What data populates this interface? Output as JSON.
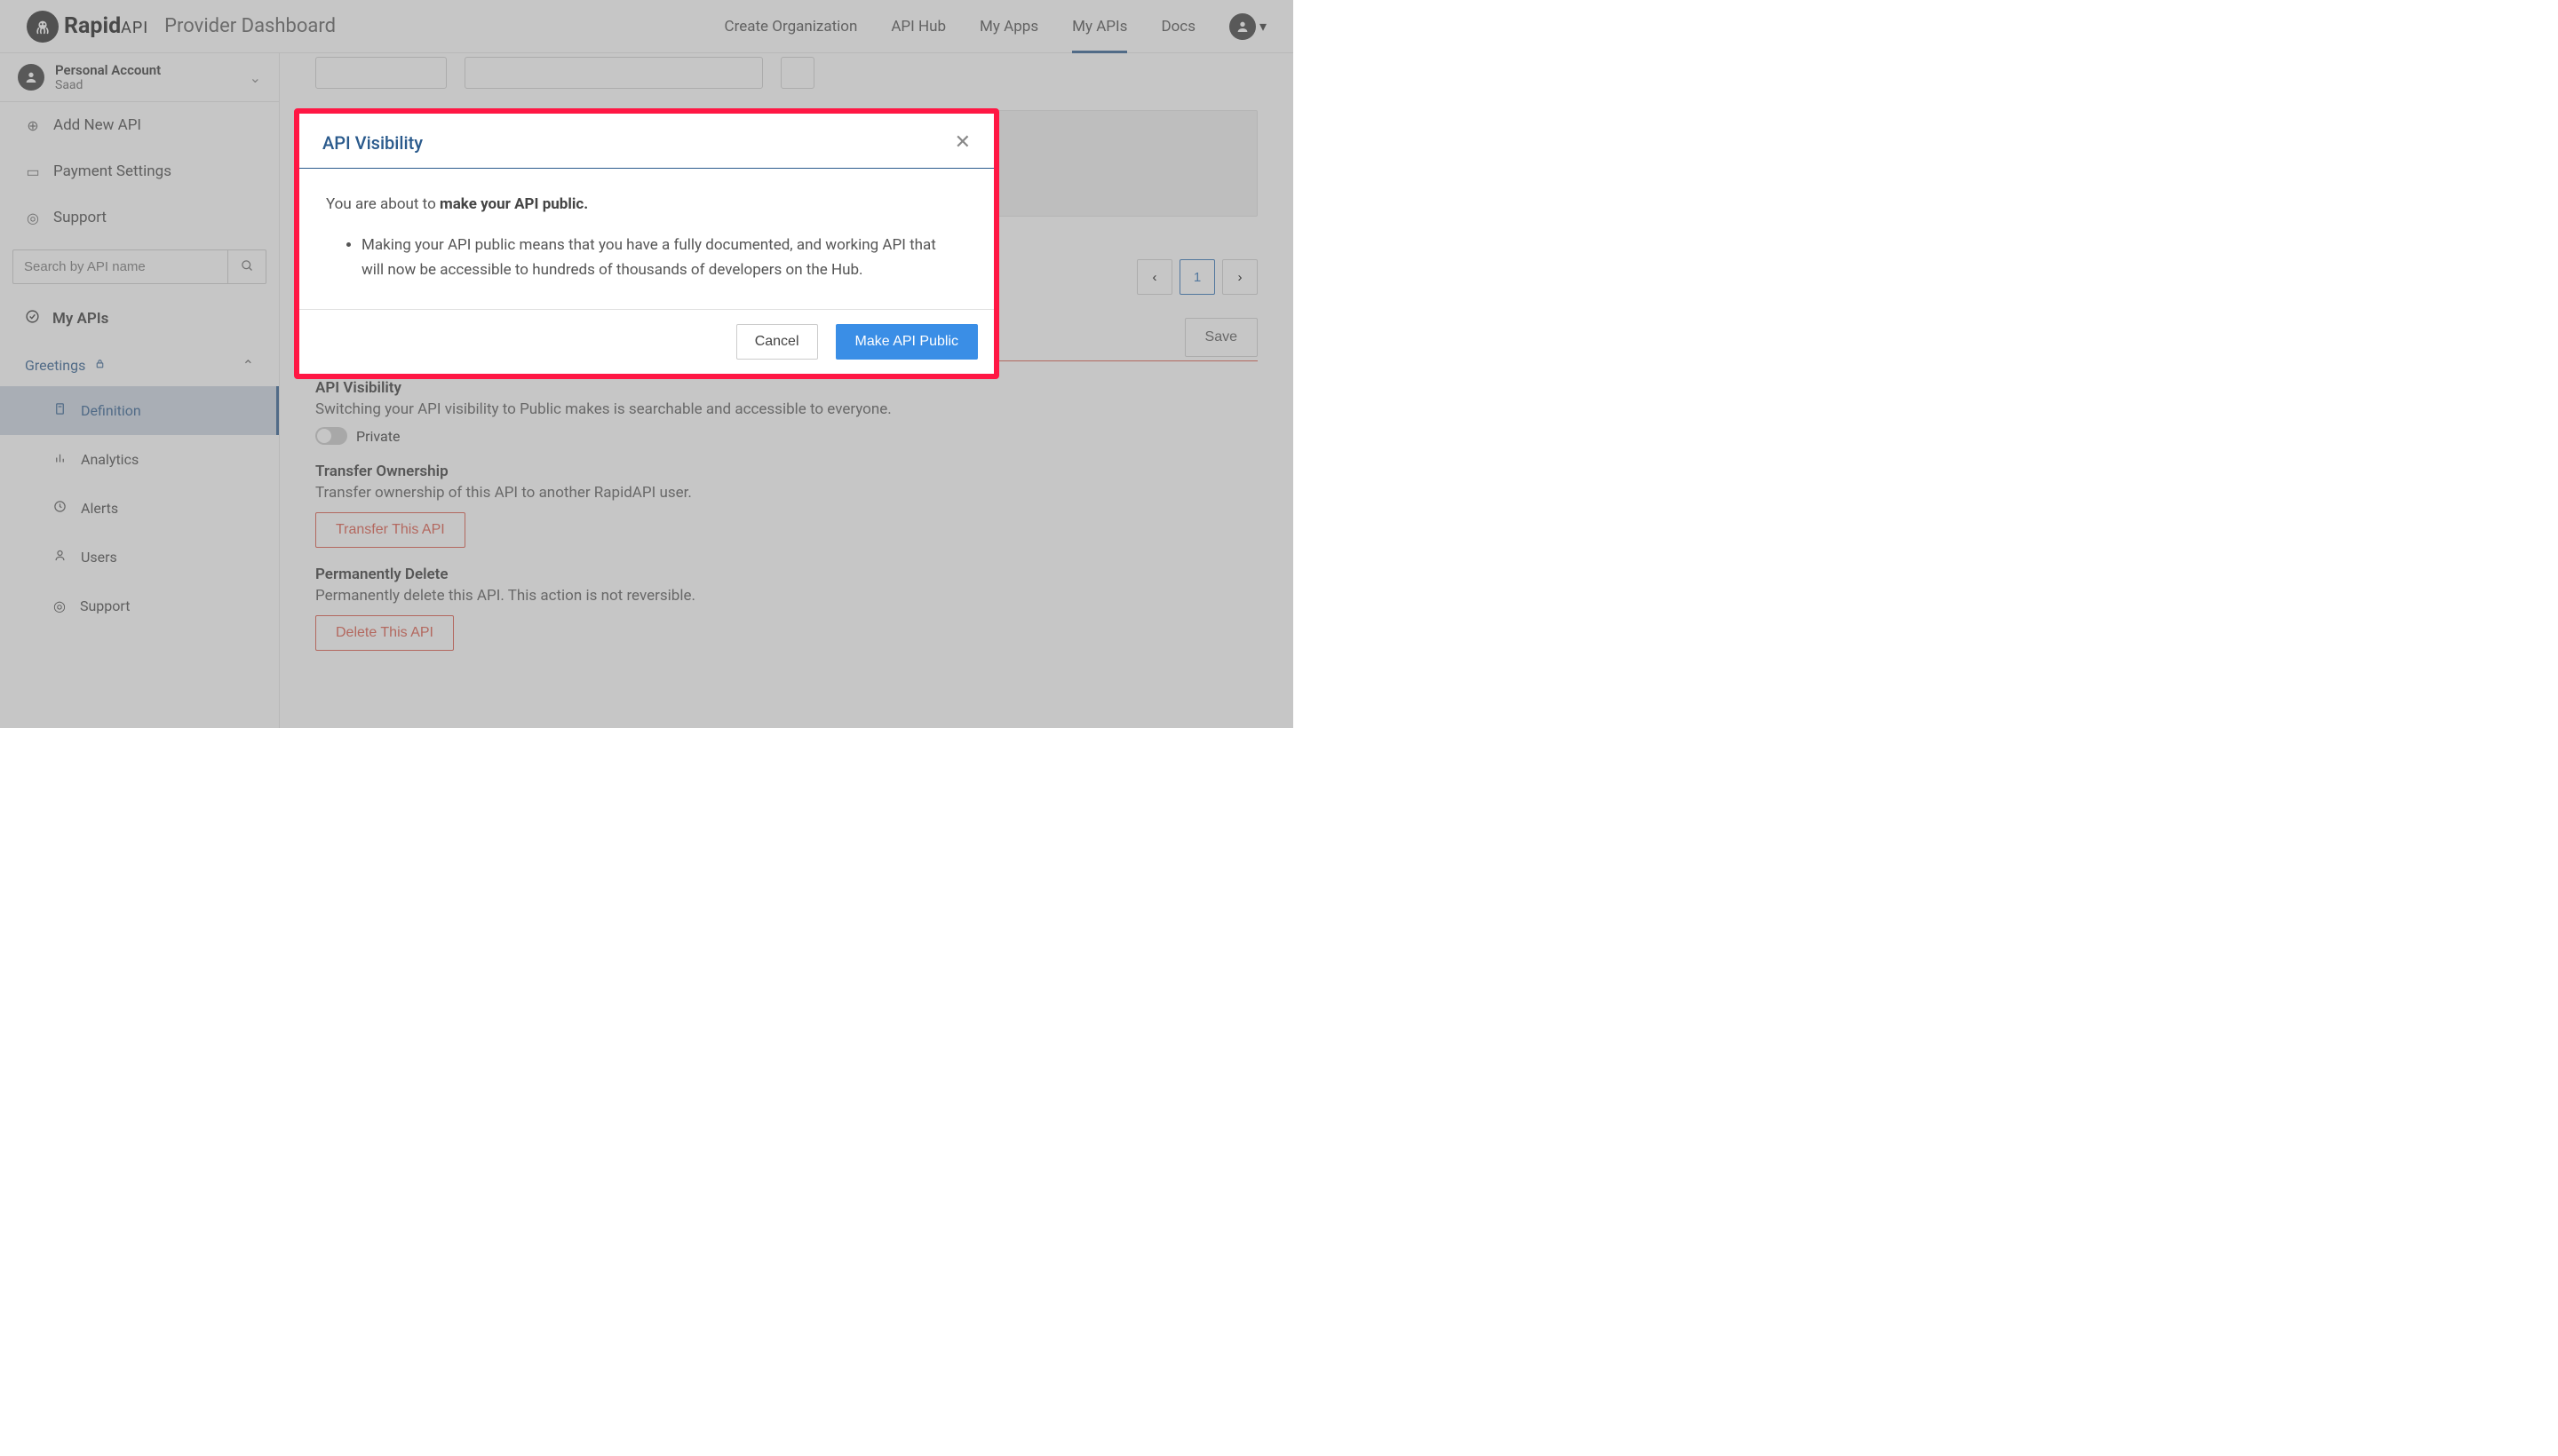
{
  "header": {
    "brand_rapid": "Rapid",
    "brand_api": "API",
    "subtitle": "Provider Dashboard",
    "nav": {
      "create_org": "Create Organization",
      "api_hub": "API Hub",
      "my_apps": "My Apps",
      "my_apis": "My APIs",
      "docs": "Docs"
    }
  },
  "account": {
    "title": "Personal Account",
    "name": "Saad"
  },
  "sidebar": {
    "add_new_api": "Add New API",
    "payment_settings": "Payment Settings",
    "support": "Support",
    "search_placeholder": "Search by API name",
    "my_apis_header": "My APIs",
    "api_name": "Greetings",
    "sub": {
      "definition": "Definition",
      "analytics": "Analytics",
      "alerts": "Alerts",
      "users": "Users",
      "support": "Support"
    }
  },
  "main": {
    "page_number": "1",
    "save": "Save",
    "sections": {
      "visibility": {
        "title": "API Visibility",
        "desc": "Switching your API visibility to Public makes is searchable and accessible to everyone.",
        "toggle_label": "Private"
      },
      "transfer": {
        "title": "Transfer Ownership",
        "desc": "Transfer ownership of this API to another RapidAPI user.",
        "button": "Transfer This API"
      },
      "delete": {
        "title": "Permanently Delete",
        "desc": "Permanently delete this API. This action is not reversible.",
        "button": "Delete This API"
      }
    }
  },
  "modal": {
    "title": "API Visibility",
    "intro_pre": "You are about to ",
    "intro_strong": "make your API public.",
    "bullet": "Making your API public means that you have a fully documented, and working API that will now be accessible to hundreds of thousands of developers on the Hub.",
    "cancel": "Cancel",
    "confirm": "Make API Public"
  }
}
